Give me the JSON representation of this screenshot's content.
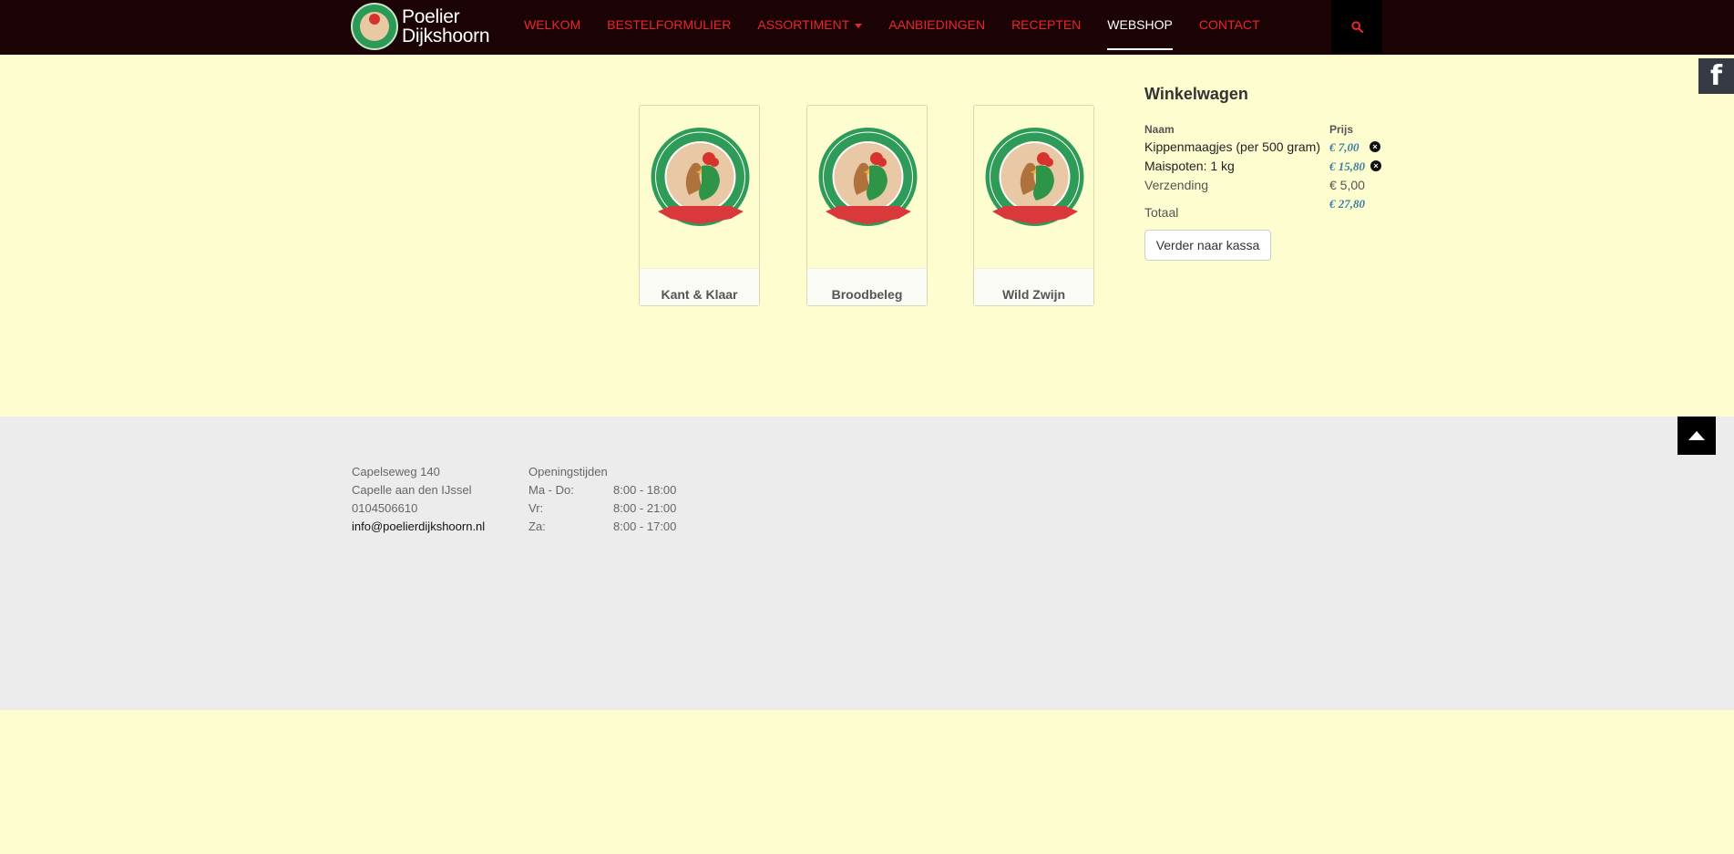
{
  "brand": {
    "line1": "Poelier",
    "line2": "Dijkshoorn"
  },
  "nav": [
    {
      "label": "WELKOM"
    },
    {
      "label": "BESTELFORMULIER"
    },
    {
      "label": "ASSORTIMENT"
    },
    {
      "label": "AANBIEDINGEN"
    },
    {
      "label": "RECEPTEN"
    },
    {
      "label": "WEBSHOP"
    },
    {
      "label": "CONTACT"
    }
  ],
  "colors": {
    "accent": "#e8262d",
    "navbar": "#1c0305",
    "page_bg": "#fefdd0",
    "price": "#3b7ea1"
  },
  "icons": {
    "search": "search-icon",
    "facebook": "facebook-icon",
    "back_to_top": "arrow-up-icon",
    "remove": "remove-icon"
  },
  "social": {
    "facebook_glyph": "f"
  },
  "products": [
    {
      "name": "Kant & Klaar"
    },
    {
      "name": "Broodbeleg"
    },
    {
      "name": "Wild Zwijn"
    }
  ],
  "cart": {
    "title": "Winkelwagen",
    "col_name": "Naam",
    "col_price": "Prijs",
    "items": [
      {
        "name": "Kippenmaagjes (per 500 gram)",
        "price": "€ 7,00"
      },
      {
        "name": "Maispoten: 1 kg",
        "price": "€ 15,80"
      }
    ],
    "shipping_label": "Verzending",
    "shipping_value": "€ 5,00",
    "total_label": "Totaal",
    "total_value": "€ 27,80",
    "checkout_label": "Verder naar kassa"
  },
  "footer": {
    "address": [
      "Capelseweg 140",
      "Capelle aan den IJssel",
      "0104506610"
    ],
    "email": "info@poelierdijkshoorn.nl",
    "hours_title": "Openingstijden",
    "hours": [
      {
        "day": "Ma - Do:",
        "time": "8:00 - 18:00"
      },
      {
        "day": "Vr:",
        "time": "8:00 - 21:00"
      },
      {
        "day": "Za:",
        "time": "8:00 - 17:00"
      }
    ]
  }
}
